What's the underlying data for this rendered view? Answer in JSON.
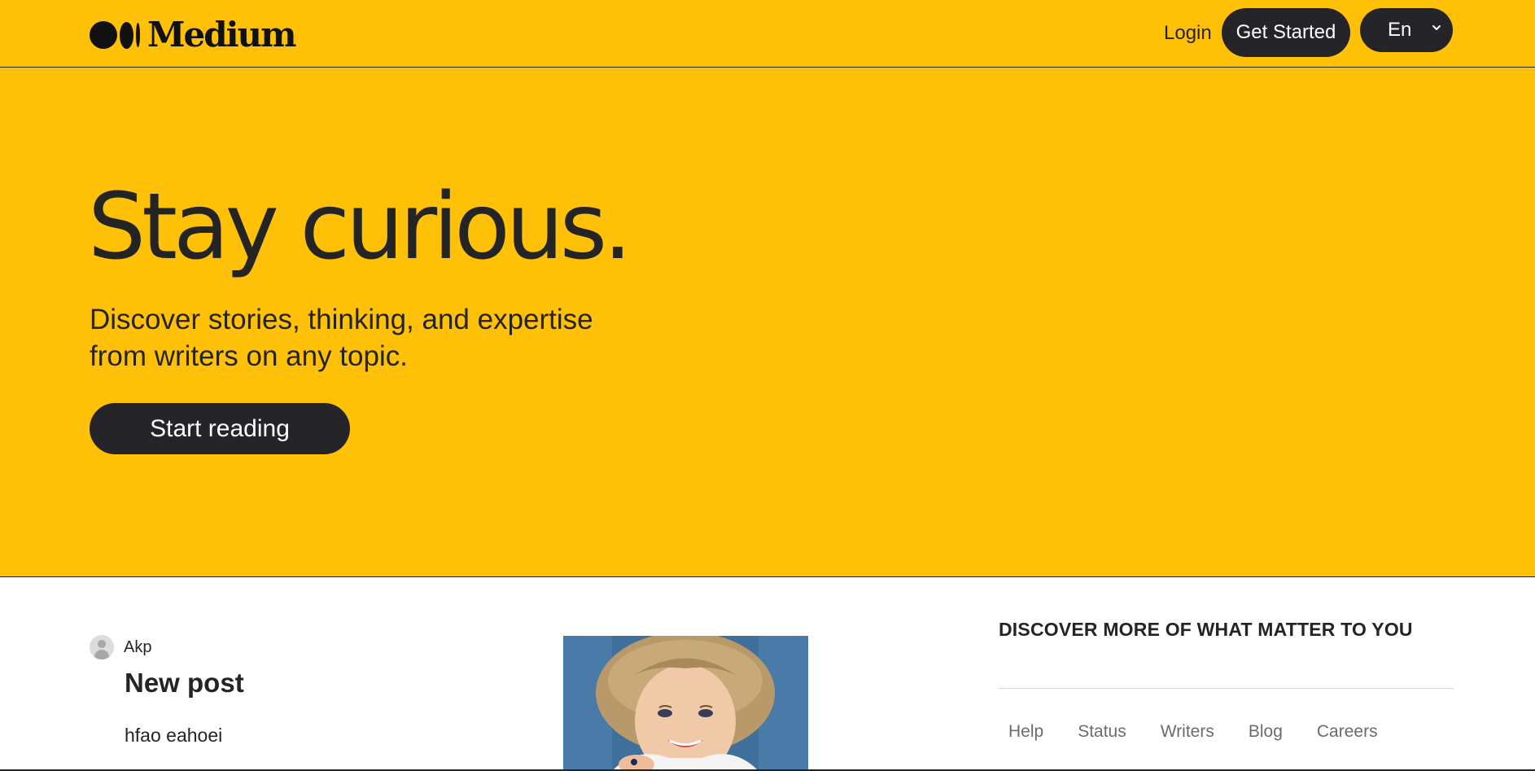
{
  "nav": {
    "brand": "Medium",
    "login_label": "Login",
    "get_started_label": "Get Started",
    "language_value": "En"
  },
  "hero": {
    "title": "Stay curious.",
    "subtitle": "Discover stories, thinking, and expertise from writers on any topic.",
    "cta_label": "Start reading",
    "background_color": "#ffc107"
  },
  "feed": {
    "posts": [
      {
        "author": "Akp",
        "title": "New post",
        "excerpt": "hfao eahoei"
      }
    ]
  },
  "discover": {
    "heading": "DISCOVER MORE OF WHAT MATTER TO YOU",
    "footer_links": [
      "Help",
      "Status",
      "Writers",
      "Blog",
      "Careers"
    ]
  },
  "colors": {
    "accent": "#ffc107",
    "button_dark": "#242429",
    "text": "#242424",
    "muted": "#6b6b6b"
  }
}
